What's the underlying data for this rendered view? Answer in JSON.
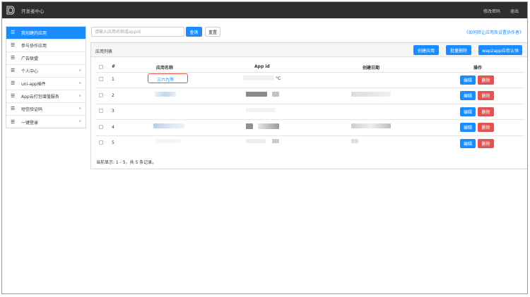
{
  "header": {
    "title": "开发者中心",
    "change_password": "修改密码",
    "logout": "退出"
  },
  "sidebar": {
    "items": [
      {
        "label": "我创建的应用",
        "active": true,
        "expandable": false
      },
      {
        "label": "参与协作应用",
        "active": false,
        "expandable": false
      },
      {
        "label": "广告联盟",
        "active": false,
        "expandable": false
      },
      {
        "label": "个人中心",
        "active": false,
        "expandable": true
      },
      {
        "label": "uni-app插件",
        "active": false,
        "expandable": true
      },
      {
        "label": "App云打包增值服务",
        "active": false,
        "expandable": true
      },
      {
        "label": "短信验证码",
        "active": false,
        "expandable": true
      },
      {
        "label": "一键登录",
        "active": false,
        "expandable": true
      }
    ]
  },
  "search": {
    "placeholder": "请输入应用名称或appid",
    "value": "",
    "query_button": "查询",
    "reset_button": "重置"
  },
  "help_link": "《如何转让应用及设置协作者》",
  "panel": {
    "title": "应用列表",
    "create_button": "创建应用",
    "batch_delete_button": "批量删除",
    "wap2app_button": "wap2app应用认领"
  },
  "table": {
    "columns": [
      "#",
      "应用名称",
      "App id",
      "创建日期",
      "操作"
    ],
    "rows": [
      {
        "index": "1",
        "name": "三六九等",
        "appid_fragment": "°C"
      },
      {
        "index": "2",
        "name": "",
        "appid_fragment": ""
      },
      {
        "index": "3",
        "name": "",
        "appid_fragment": ""
      },
      {
        "index": "4",
        "name": "",
        "appid_fragment": ""
      },
      {
        "index": "5",
        "name": "",
        "appid_fragment": ""
      }
    ],
    "edit_label": "编辑",
    "delete_label": "删除"
  },
  "footer": {
    "summary": "当前显示: 1 - 5，共 5 条记录。"
  },
  "colors": {
    "topbar": "#2e2e2e",
    "primary": "#1a8cfe",
    "danger": "#e05454",
    "highlight": "#e8553e"
  }
}
